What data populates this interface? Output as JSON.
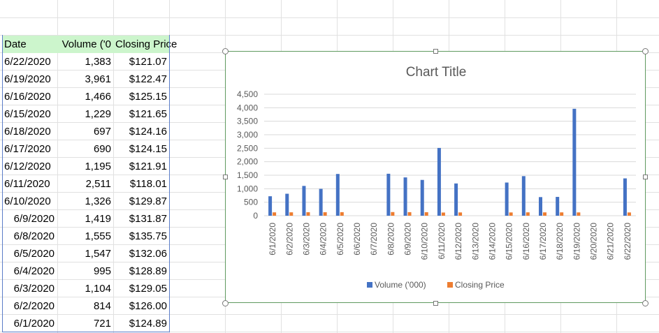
{
  "sheet": {
    "headers": {
      "date": "Date",
      "volume": "Volume ('0",
      "price": "Closing Price"
    },
    "rows": [
      {
        "date": "6/22/2020",
        "volume": "1,383",
        "price": "$121.07"
      },
      {
        "date": "6/19/2020",
        "volume": "3,961",
        "price": "$122.47"
      },
      {
        "date": "6/16/2020",
        "volume": "1,466",
        "price": "$125.15"
      },
      {
        "date": "6/15/2020",
        "volume": "1,229",
        "price": "$121.65"
      },
      {
        "date": "6/18/2020",
        "volume": "697",
        "price": "$124.16"
      },
      {
        "date": "6/17/2020",
        "volume": "690",
        "price": "$124.15"
      },
      {
        "date": "6/12/2020",
        "volume": "1,195",
        "price": "$121.91"
      },
      {
        "date": "6/11/2020",
        "volume": "2,511",
        "price": "$118.01"
      },
      {
        "date": "6/10/2020",
        "volume": "1,326",
        "price": "$129.87"
      },
      {
        "date": "6/9/2020",
        "volume": "1,419",
        "price": "$131.87"
      },
      {
        "date": "6/8/2020",
        "volume": "1,555",
        "price": "$135.75"
      },
      {
        "date": "6/5/2020",
        "volume": "1,547",
        "price": "$132.06"
      },
      {
        "date": "6/4/2020",
        "volume": "995",
        "price": "$128.89"
      },
      {
        "date": "6/3/2020",
        "volume": "1,104",
        "price": "$129.05"
      },
      {
        "date": "6/2/2020",
        "volume": "814",
        "price": "$126.00"
      },
      {
        "date": "6/1/2020",
        "volume": "721",
        "price": "$124.89"
      }
    ]
  },
  "colors": {
    "volume": "#4472c4",
    "price": "#ed7d31",
    "header_fill": "#ccf5cc",
    "gridline": "#d9d9d9"
  },
  "chart_data": {
    "type": "bar",
    "title": "Chart Title",
    "categories": [
      "6/1/2020",
      "6/2/2020",
      "6/3/2020",
      "6/4/2020",
      "6/5/2020",
      "6/6/2020",
      "6/7/2020",
      "6/8/2020",
      "6/9/2020",
      "6/10/2020",
      "6/11/2020",
      "6/12/2020",
      "6/13/2020",
      "6/14/2020",
      "6/15/2020",
      "6/16/2020",
      "6/17/2020",
      "6/18/2020",
      "6/19/2020",
      "6/20/2020",
      "6/21/2020",
      "6/22/2020"
    ],
    "series": [
      {
        "name": "Volume ('000)",
        "values": [
          721,
          814,
          1104,
          995,
          1547,
          null,
          null,
          1555,
          1419,
          1326,
          2511,
          1195,
          null,
          null,
          1229,
          1466,
          690,
          697,
          3961,
          null,
          null,
          1383
        ]
      },
      {
        "name": "Closing Price",
        "values": [
          124.89,
          126.0,
          129.05,
          128.89,
          132.06,
          null,
          null,
          135.75,
          131.87,
          129.87,
          118.01,
          121.91,
          null,
          null,
          121.65,
          125.15,
          124.15,
          124.16,
          122.47,
          null,
          null,
          121.07
        ]
      }
    ],
    "yticks": [
      "0",
      "500",
      "1,000",
      "1,500",
      "2,000",
      "2,500",
      "3,000",
      "3,500",
      "4,000",
      "4,500"
    ],
    "ylim": [
      0,
      4500
    ],
    "grid": true,
    "legend": "bottom"
  }
}
